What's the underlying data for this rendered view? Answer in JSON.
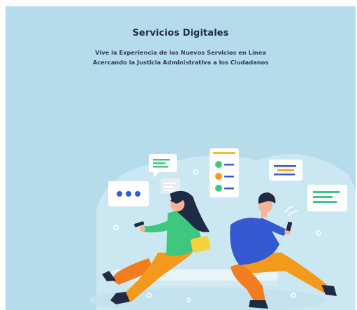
{
  "hero": {
    "title": "Servicios Digitales",
    "subtitle_line1": "Vive la Experiencia de los Nuevos Servicios en Línea",
    "subtitle_line2": "Acercando la Justicia Administrativa a los Ciudadanos"
  },
  "illustration": {
    "name": "two-people-using-phones",
    "icons": [
      "chat-bubble-icon",
      "typing-dots-icon",
      "contacts-list-icon",
      "message-card-icon",
      "wifi-signal-icon"
    ]
  },
  "colors": {
    "background": "#b6dcec",
    "title": "#1f2a44",
    "accent_green": "#3fc77f",
    "accent_orange": "#f39a1c",
    "accent_blue": "#3559d1",
    "accent_yellow": "#f6d33c"
  }
}
